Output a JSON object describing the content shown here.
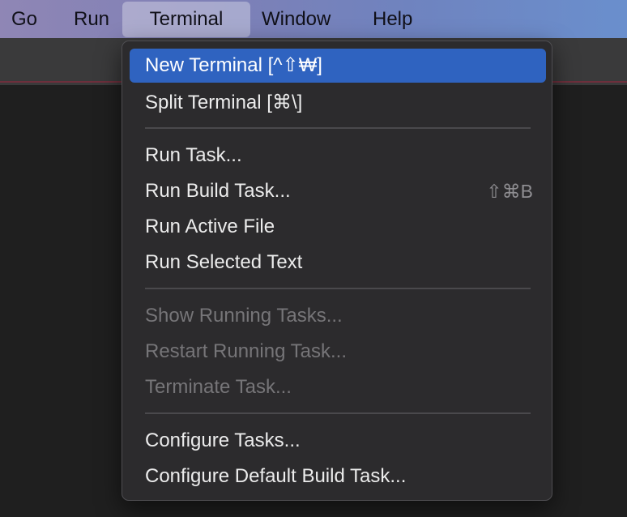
{
  "menubar": {
    "items": [
      {
        "label": "Go"
      },
      {
        "label": "Run"
      },
      {
        "label": "Terminal"
      },
      {
        "label": "Window"
      },
      {
        "label": "Help"
      }
    ]
  },
  "terminal_menu": {
    "items": [
      {
        "label": "New Terminal [^⇧₩]",
        "shortcut": "",
        "state": "highlighted"
      },
      {
        "label": "Split Terminal [⌘\\]",
        "shortcut": "",
        "state": "enabled"
      },
      {
        "label": "Run Task...",
        "shortcut": "",
        "state": "enabled"
      },
      {
        "label": "Run Build Task...",
        "shortcut": "⇧⌘B",
        "state": "enabled"
      },
      {
        "label": "Run Active File",
        "shortcut": "",
        "state": "enabled"
      },
      {
        "label": "Run Selected Text",
        "shortcut": "",
        "state": "enabled"
      },
      {
        "label": "Show Running Tasks...",
        "shortcut": "",
        "state": "disabled"
      },
      {
        "label": "Restart Running Task...",
        "shortcut": "",
        "state": "disabled"
      },
      {
        "label": "Terminate Task...",
        "shortcut": "",
        "state": "disabled"
      },
      {
        "label": "Configure Tasks...",
        "shortcut": "",
        "state": "enabled"
      },
      {
        "label": "Configure Default Build Task...",
        "shortcut": "",
        "state": "enabled"
      }
    ]
  },
  "colors": {
    "highlight": "#2f63c0",
    "menu_background": "#2c2b2d",
    "disabled_text": "#767578"
  }
}
